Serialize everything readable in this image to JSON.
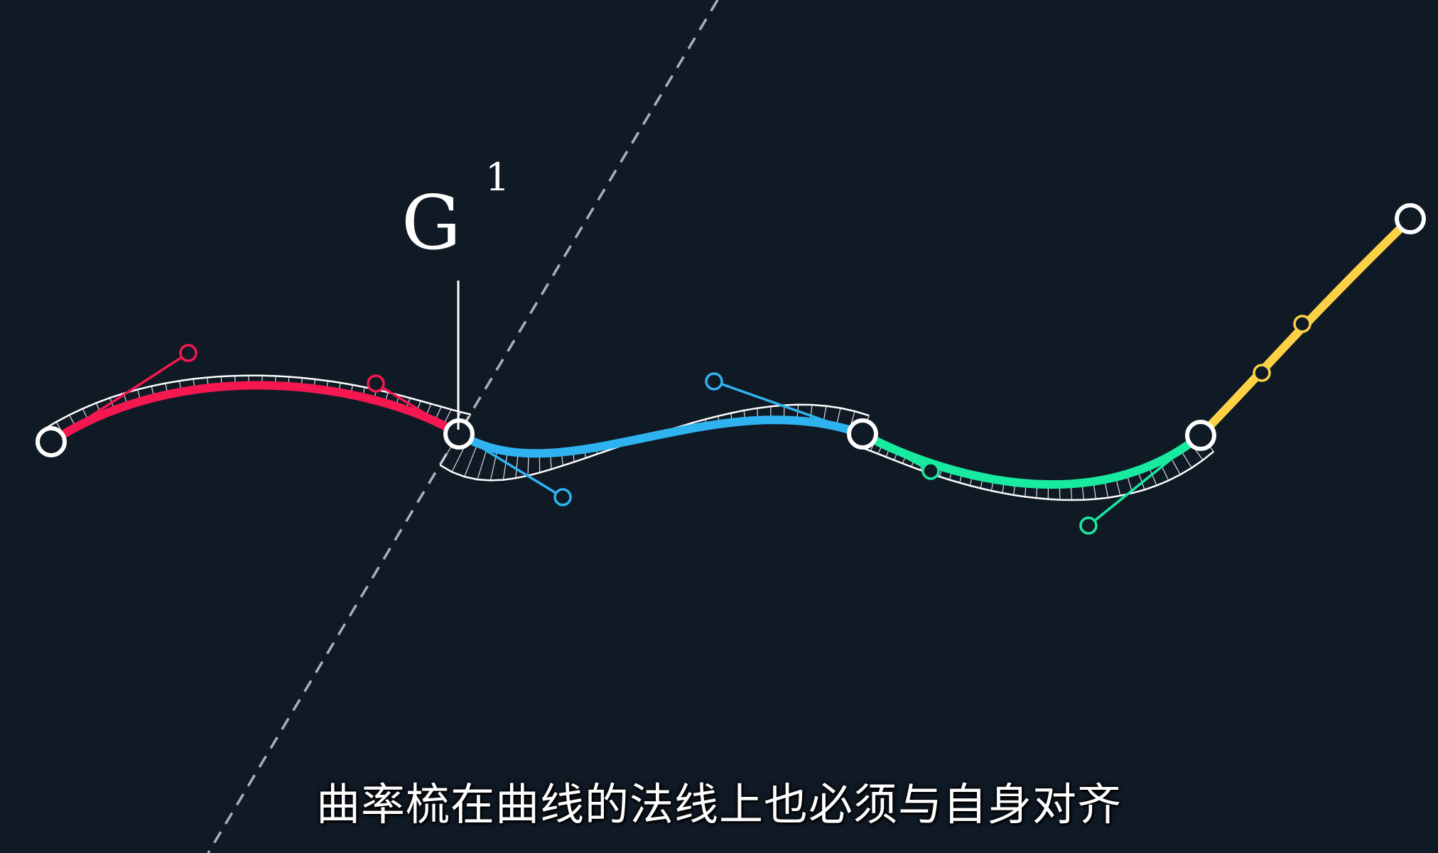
{
  "label": {
    "base": "G",
    "superscript": "1"
  },
  "subtitle": "曲率梳在曲线的法线上也必须与自身对齐",
  "colors": {
    "background": "#101a25",
    "segment_1": "#f5174f",
    "segment_2": "#2fb3f0",
    "segment_3": "#18eaa0",
    "segment_4": "#fcd145",
    "comb": "#ffffff",
    "tangent_line": "#a7b0ba"
  },
  "segments": [
    {
      "name": "red-segment",
      "color_key": "segment_1"
    },
    {
      "name": "blue-segment",
      "color_key": "segment_2"
    },
    {
      "name": "green-segment",
      "color_key": "segment_3"
    },
    {
      "name": "yellow-segment",
      "color_key": "segment_4"
    }
  ]
}
